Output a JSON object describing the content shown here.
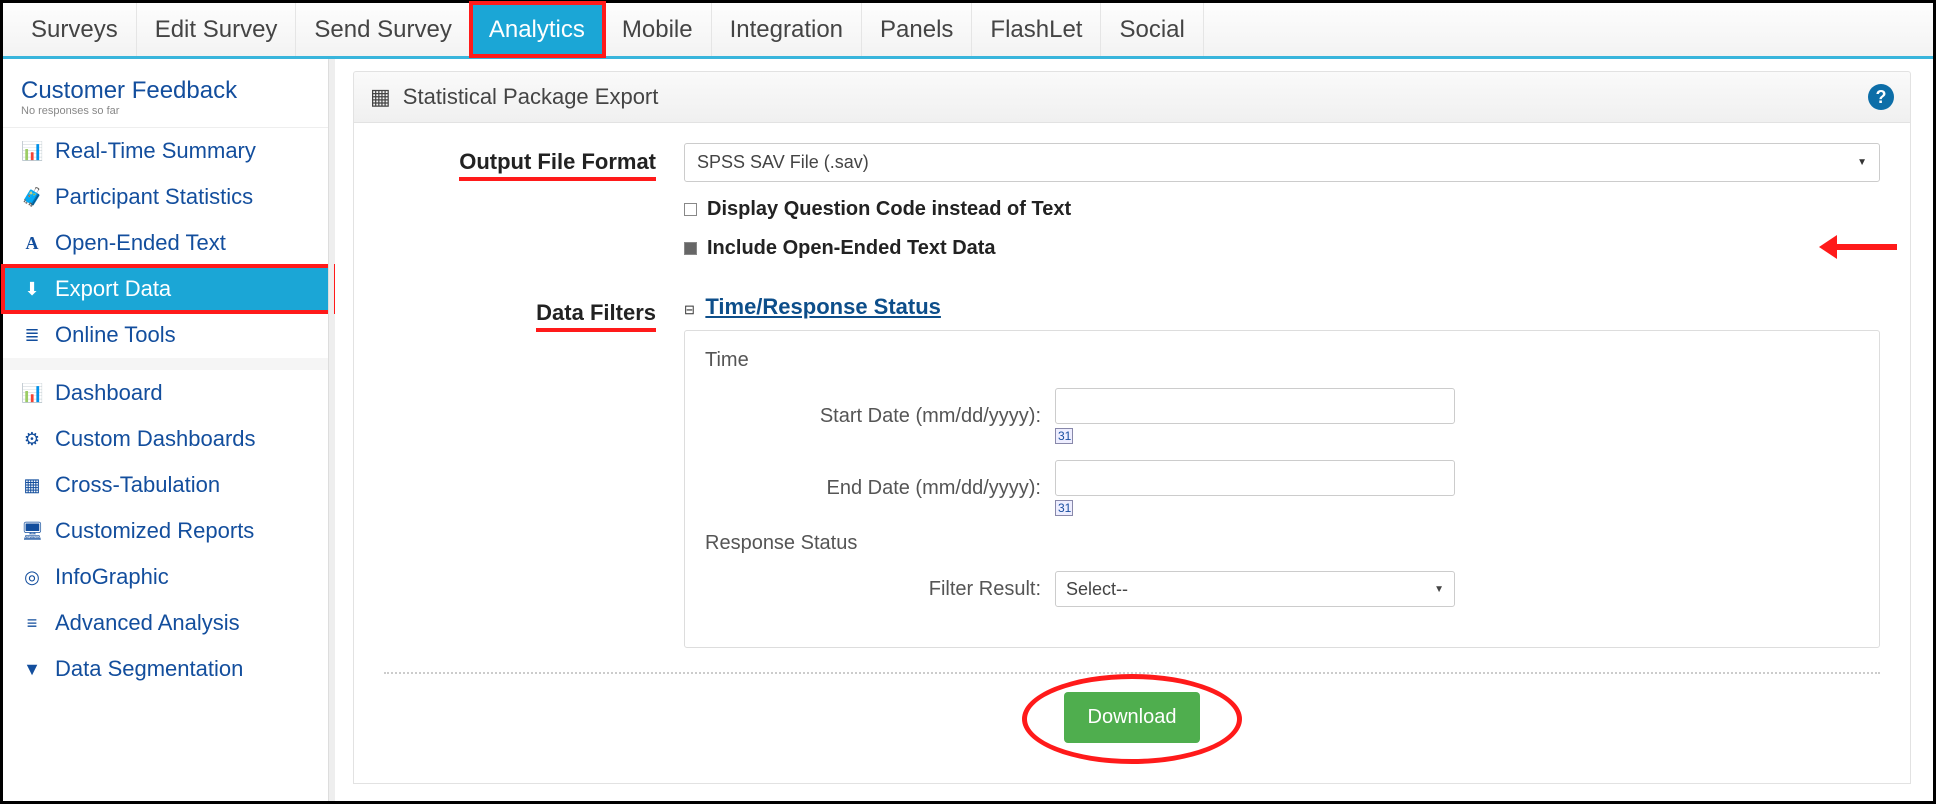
{
  "topnav": {
    "tabs": [
      {
        "label": "Surveys"
      },
      {
        "label": "Edit Survey"
      },
      {
        "label": "Send Survey"
      },
      {
        "label": "Analytics",
        "active": true,
        "highlight": true
      },
      {
        "label": "Mobile"
      },
      {
        "label": "Integration"
      },
      {
        "label": "Panels"
      },
      {
        "label": "FlashLet"
      },
      {
        "label": "Social"
      }
    ]
  },
  "sidebar": {
    "title": "Customer Feedback",
    "subtitle": "No responses so far",
    "items": [
      {
        "icon": "📊",
        "label": "Real-Time Summary"
      },
      {
        "icon": "🧳",
        "label": "Participant Statistics"
      },
      {
        "icon": "A",
        "label": "Open-Ended Text"
      },
      {
        "icon": "⬇",
        "label": "Export Data",
        "selected": true,
        "highlight": true
      },
      {
        "icon": "≣",
        "label": "Online Tools"
      }
    ],
    "items2": [
      {
        "icon": "📊",
        "label": "Dashboard"
      },
      {
        "icon": "⚙",
        "label": "Custom Dashboards"
      },
      {
        "icon": "▦",
        "label": "Cross-Tabulation"
      },
      {
        "icon": "🖥",
        "label": "Customized Reports"
      },
      {
        "icon": "◎",
        "label": "InfoGraphic"
      },
      {
        "icon": "≡",
        "label": "Advanced Analysis"
      },
      {
        "icon": "▼",
        "label": "Data Segmentation"
      }
    ]
  },
  "panel": {
    "title": "Statistical Package Export",
    "help_tooltip": "?",
    "output_format_label": "Output File Format",
    "output_format_value": "SPSS SAV File (.sav)",
    "checkbox1_label": "Display Question Code instead of Text",
    "checkbox1_checked": false,
    "checkbox2_label": "Include Open-Ended Text Data",
    "checkbox2_checked": true,
    "data_filters_label": "Data Filters",
    "collapse_label": "Time/Response Status",
    "filters": {
      "time_heading": "Time",
      "start_date_label": "Start Date (mm/dd/yyyy):",
      "start_date_value": "",
      "end_date_label": "End Date (mm/dd/yyyy):",
      "end_date_value": "",
      "response_status_heading": "Response Status",
      "filter_result_label": "Filter Result:",
      "filter_result_value": "Select--"
    },
    "download_label": "Download"
  }
}
